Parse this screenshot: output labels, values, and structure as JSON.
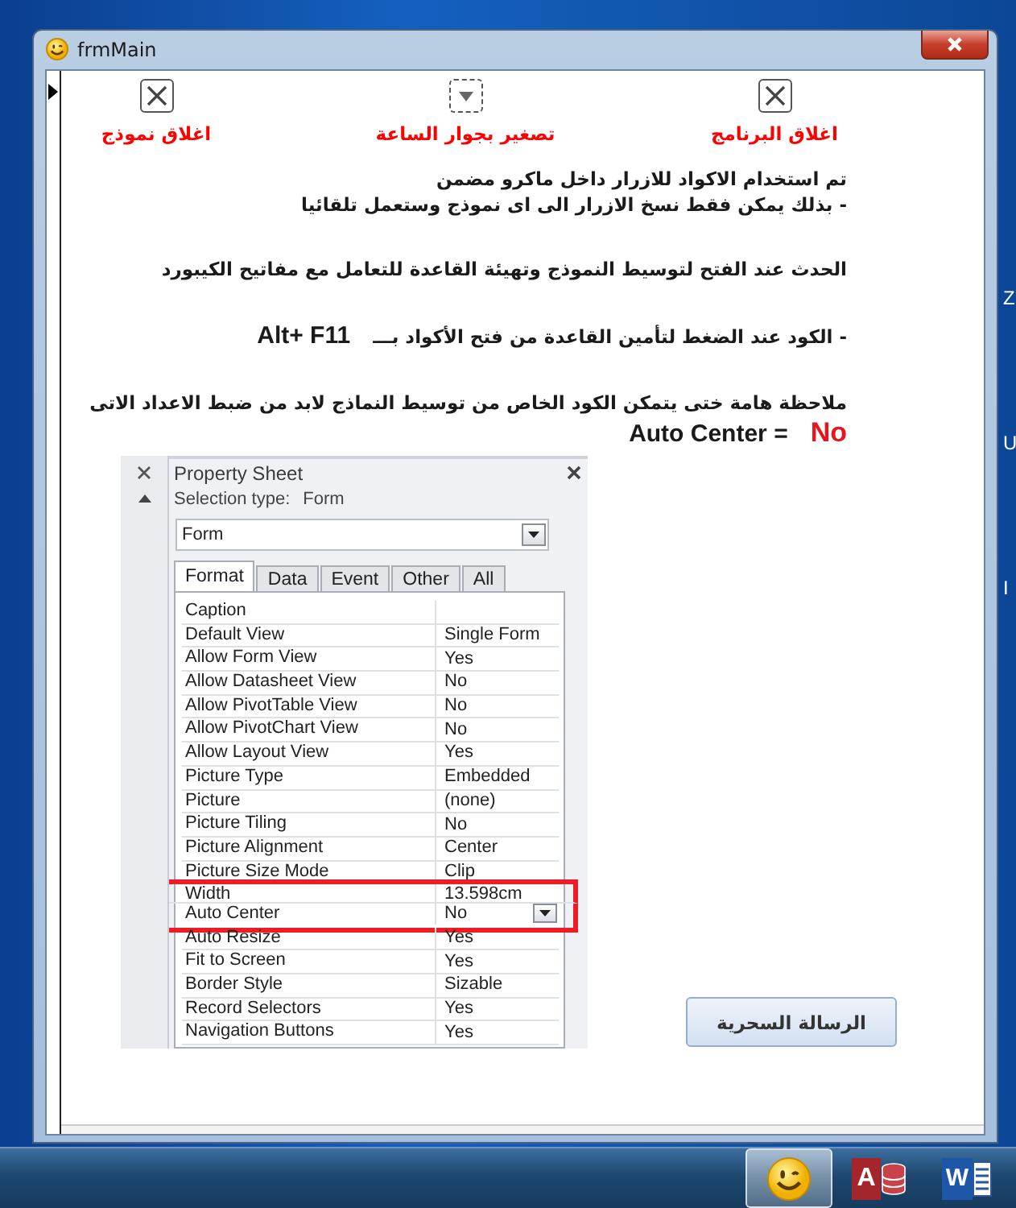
{
  "window": {
    "title": "frmMain"
  },
  "top_buttons": [
    {
      "kind": "close",
      "label": "اغلاق البرنامج"
    },
    {
      "kind": "minimize",
      "label": "تصغير بجوار الساعة"
    },
    {
      "kind": "close",
      "label": "اغلاق نموذج"
    }
  ],
  "notes": [
    {
      "lines": [
        [
          {
            "kind": "arabic",
            "text": "تم استخدام الاكواد للازرار داخل ماكرو مضمن"
          }
        ],
        [
          {
            "kind": "arabic",
            "text": "- بذلك يمكن فقط نسخ الازرار الى اى نموذج وستعمل تلقائيا"
          }
        ]
      ]
    },
    {
      "lines": [
        [
          {
            "kind": "arabic",
            "text": "الحدث عند الفتح لتوسيط النموذج وتهيئة القاعدة للتعامل مع مفاتيح الكيبورد"
          }
        ]
      ]
    },
    {
      "lines": [
        [
          {
            "kind": "latin",
            "text": "Alt+ F11"
          },
          {
            "kind": "arabic",
            "text": "- الكود عند الضغط لتأمين القاعدة من فتح الأكواد بـــ"
          }
        ]
      ]
    },
    {
      "lines": [
        [
          {
            "kind": "arabic",
            "text": "ملاحظة هامة ختى يتمكن الكود الخاص من توسيط النماذج لابد من ضبط الاعداد الاتى"
          }
        ],
        [
          {
            "kind": "latin",
            "text": "Auto Center ="
          },
          {
            "kind": "highlight",
            "text": "No"
          }
        ]
      ]
    }
  ],
  "property_sheet": {
    "title": "Property Sheet",
    "selection_label": "Selection type:",
    "selection_value": "Form",
    "object": "Form",
    "tabs": [
      {
        "label": "Format",
        "selected": true
      },
      {
        "label": "Data",
        "selected": false
      },
      {
        "label": "Event",
        "selected": false
      },
      {
        "label": "Other",
        "selected": false
      },
      {
        "label": "All",
        "selected": false
      }
    ],
    "rows": [
      {
        "name": "Caption",
        "value": "",
        "highlighted": false,
        "dropdown": false
      },
      {
        "name": "Default View",
        "value": "Single Form",
        "highlighted": false,
        "dropdown": false
      },
      {
        "name": "Allow Form View",
        "value": "Yes",
        "highlighted": false,
        "dropdown": false
      },
      {
        "name": "Allow Datasheet View",
        "value": "No",
        "highlighted": false,
        "dropdown": false
      },
      {
        "name": "Allow PivotTable View",
        "value": "No",
        "highlighted": false,
        "dropdown": false
      },
      {
        "name": "Allow PivotChart View",
        "value": "No",
        "highlighted": false,
        "dropdown": false
      },
      {
        "name": "Allow Layout View",
        "value": "Yes",
        "highlighted": false,
        "dropdown": false
      },
      {
        "name": "Picture Type",
        "value": "Embedded",
        "highlighted": false,
        "dropdown": false
      },
      {
        "name": "Picture",
        "value": "(none)",
        "highlighted": false,
        "dropdown": false
      },
      {
        "name": "Picture Tiling",
        "value": "No",
        "highlighted": false,
        "dropdown": false
      },
      {
        "name": "Picture Alignment",
        "value": "Center",
        "highlighted": false,
        "dropdown": false
      },
      {
        "name": "Picture Size Mode",
        "value": "Clip",
        "highlighted": false,
        "dropdown": false
      },
      {
        "name": "Width",
        "value": "13.598cm",
        "highlighted": true,
        "dropdown": false
      },
      {
        "name": "Auto Center",
        "value": "No",
        "highlighted": true,
        "dropdown": true
      },
      {
        "name": "Auto Resize",
        "value": "Yes",
        "highlighted": false,
        "dropdown": false
      },
      {
        "name": "Fit to Screen",
        "value": "Yes",
        "highlighted": false,
        "dropdown": false
      },
      {
        "name": "Border Style",
        "value": "Sizable",
        "highlighted": false,
        "dropdown": false
      },
      {
        "name": "Record Selectors",
        "value": "Yes",
        "highlighted": false,
        "dropdown": false
      },
      {
        "name": "Navigation Buttons",
        "value": "Yes",
        "highlighted": false,
        "dropdown": false
      }
    ]
  },
  "action_button": {
    "label": "الرسالة السحرية"
  },
  "desktop_fragments": [
    "Z",
    "U",
    "I"
  ],
  "taskbar": {
    "items": [
      {
        "kind": "smiley",
        "active": true
      },
      {
        "kind": "database",
        "letter": "A",
        "active": false
      },
      {
        "kind": "document",
        "letter": "W",
        "active": false
      }
    ]
  }
}
